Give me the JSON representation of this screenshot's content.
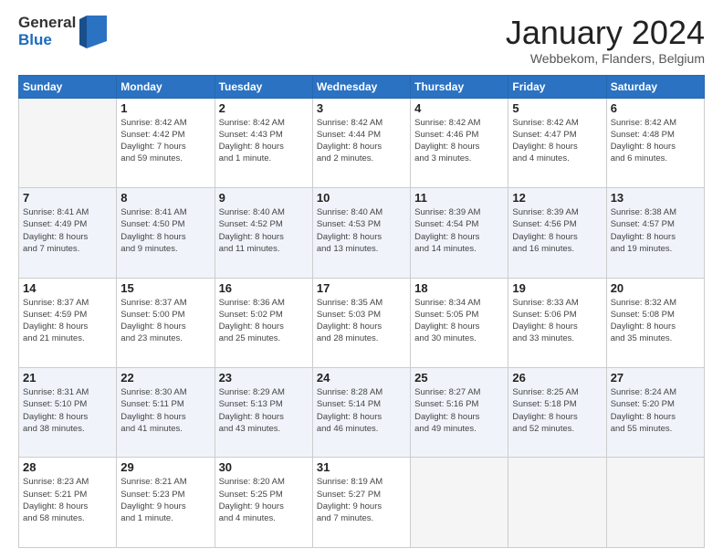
{
  "header": {
    "logo_line1": "General",
    "logo_line2": "Blue",
    "month_title": "January 2024",
    "subtitle": "Webbekom, Flanders, Belgium"
  },
  "weekdays": [
    "Sunday",
    "Monday",
    "Tuesday",
    "Wednesday",
    "Thursday",
    "Friday",
    "Saturday"
  ],
  "weeks": [
    [
      {
        "day": "",
        "info": ""
      },
      {
        "day": "1",
        "info": "Sunrise: 8:42 AM\nSunset: 4:42 PM\nDaylight: 7 hours\nand 59 minutes."
      },
      {
        "day": "2",
        "info": "Sunrise: 8:42 AM\nSunset: 4:43 PM\nDaylight: 8 hours\nand 1 minute."
      },
      {
        "day": "3",
        "info": "Sunrise: 8:42 AM\nSunset: 4:44 PM\nDaylight: 8 hours\nand 2 minutes."
      },
      {
        "day": "4",
        "info": "Sunrise: 8:42 AM\nSunset: 4:46 PM\nDaylight: 8 hours\nand 3 minutes."
      },
      {
        "day": "5",
        "info": "Sunrise: 8:42 AM\nSunset: 4:47 PM\nDaylight: 8 hours\nand 4 minutes."
      },
      {
        "day": "6",
        "info": "Sunrise: 8:42 AM\nSunset: 4:48 PM\nDaylight: 8 hours\nand 6 minutes."
      }
    ],
    [
      {
        "day": "7",
        "info": "Sunrise: 8:41 AM\nSunset: 4:49 PM\nDaylight: 8 hours\nand 7 minutes."
      },
      {
        "day": "8",
        "info": "Sunrise: 8:41 AM\nSunset: 4:50 PM\nDaylight: 8 hours\nand 9 minutes."
      },
      {
        "day": "9",
        "info": "Sunrise: 8:40 AM\nSunset: 4:52 PM\nDaylight: 8 hours\nand 11 minutes."
      },
      {
        "day": "10",
        "info": "Sunrise: 8:40 AM\nSunset: 4:53 PM\nDaylight: 8 hours\nand 13 minutes."
      },
      {
        "day": "11",
        "info": "Sunrise: 8:39 AM\nSunset: 4:54 PM\nDaylight: 8 hours\nand 14 minutes."
      },
      {
        "day": "12",
        "info": "Sunrise: 8:39 AM\nSunset: 4:56 PM\nDaylight: 8 hours\nand 16 minutes."
      },
      {
        "day": "13",
        "info": "Sunrise: 8:38 AM\nSunset: 4:57 PM\nDaylight: 8 hours\nand 19 minutes."
      }
    ],
    [
      {
        "day": "14",
        "info": "Sunrise: 8:37 AM\nSunset: 4:59 PM\nDaylight: 8 hours\nand 21 minutes."
      },
      {
        "day": "15",
        "info": "Sunrise: 8:37 AM\nSunset: 5:00 PM\nDaylight: 8 hours\nand 23 minutes."
      },
      {
        "day": "16",
        "info": "Sunrise: 8:36 AM\nSunset: 5:02 PM\nDaylight: 8 hours\nand 25 minutes."
      },
      {
        "day": "17",
        "info": "Sunrise: 8:35 AM\nSunset: 5:03 PM\nDaylight: 8 hours\nand 28 minutes."
      },
      {
        "day": "18",
        "info": "Sunrise: 8:34 AM\nSunset: 5:05 PM\nDaylight: 8 hours\nand 30 minutes."
      },
      {
        "day": "19",
        "info": "Sunrise: 8:33 AM\nSunset: 5:06 PM\nDaylight: 8 hours\nand 33 minutes."
      },
      {
        "day": "20",
        "info": "Sunrise: 8:32 AM\nSunset: 5:08 PM\nDaylight: 8 hours\nand 35 minutes."
      }
    ],
    [
      {
        "day": "21",
        "info": "Sunrise: 8:31 AM\nSunset: 5:10 PM\nDaylight: 8 hours\nand 38 minutes."
      },
      {
        "day": "22",
        "info": "Sunrise: 8:30 AM\nSunset: 5:11 PM\nDaylight: 8 hours\nand 41 minutes."
      },
      {
        "day": "23",
        "info": "Sunrise: 8:29 AM\nSunset: 5:13 PM\nDaylight: 8 hours\nand 43 minutes."
      },
      {
        "day": "24",
        "info": "Sunrise: 8:28 AM\nSunset: 5:14 PM\nDaylight: 8 hours\nand 46 minutes."
      },
      {
        "day": "25",
        "info": "Sunrise: 8:27 AM\nSunset: 5:16 PM\nDaylight: 8 hours\nand 49 minutes."
      },
      {
        "day": "26",
        "info": "Sunrise: 8:25 AM\nSunset: 5:18 PM\nDaylight: 8 hours\nand 52 minutes."
      },
      {
        "day": "27",
        "info": "Sunrise: 8:24 AM\nSunset: 5:20 PM\nDaylight: 8 hours\nand 55 minutes."
      }
    ],
    [
      {
        "day": "28",
        "info": "Sunrise: 8:23 AM\nSunset: 5:21 PM\nDaylight: 8 hours\nand 58 minutes."
      },
      {
        "day": "29",
        "info": "Sunrise: 8:21 AM\nSunset: 5:23 PM\nDaylight: 9 hours\nand 1 minute."
      },
      {
        "day": "30",
        "info": "Sunrise: 8:20 AM\nSunset: 5:25 PM\nDaylight: 9 hours\nand 4 minutes."
      },
      {
        "day": "31",
        "info": "Sunrise: 8:19 AM\nSunset: 5:27 PM\nDaylight: 9 hours\nand 7 minutes."
      },
      {
        "day": "",
        "info": ""
      },
      {
        "day": "",
        "info": ""
      },
      {
        "day": "",
        "info": ""
      }
    ]
  ]
}
